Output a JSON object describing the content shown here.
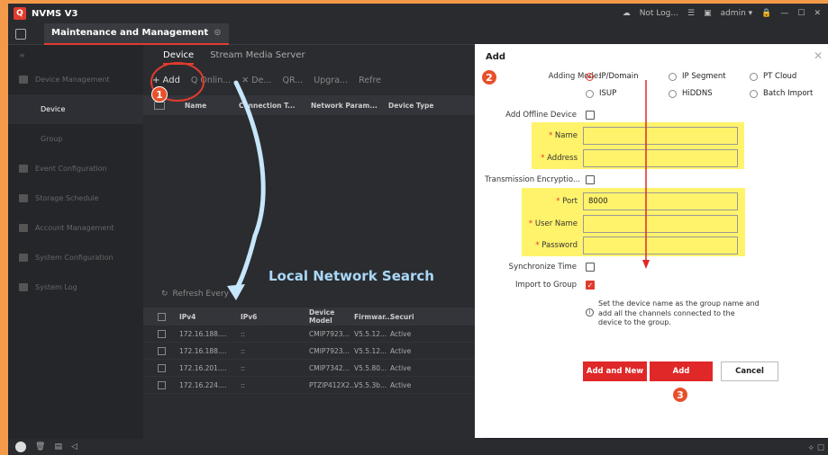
{
  "app": {
    "title": "NVMS V3",
    "logo_letter": "Q"
  },
  "titlebar": {
    "not_logged": "Not Log...",
    "user": "admin ▾"
  },
  "tab": {
    "label": "Maintenance and Management"
  },
  "sidebar": {
    "items": [
      {
        "label": "Device Management"
      },
      {
        "label": "Device"
      },
      {
        "label": "Group"
      },
      {
        "label": "Event Configuration"
      },
      {
        "label": "Storage Schedule"
      },
      {
        "label": "Account Management"
      },
      {
        "label": "System Configuration"
      },
      {
        "label": "System Log"
      }
    ]
  },
  "main": {
    "subtabs": [
      "Device",
      "Stream Media Server"
    ],
    "toolbar": {
      "add": "+ Add",
      "online": "Q Onlin...",
      "delete": "✕ De...",
      "qr": "QR...",
      "upgrade": "Upgra...",
      "refresh": "Refre"
    },
    "table_headers": [
      "Name",
      "Connection T...",
      "Network Param...",
      "Device Type"
    ],
    "refresh_every": "Refresh Every",
    "local_search_headers": [
      "IPv4",
      "IPv6",
      "Device Model",
      "Firmwar...",
      "Securi"
    ],
    "rows": [
      [
        "172.16.188....",
        "::",
        "CMIP7923...",
        "V5.5.12...",
        "Active"
      ],
      [
        "172.16.188....",
        "::",
        "CMIP7923...",
        "V5.5.12...",
        "Active"
      ],
      [
        "172.16.201....",
        "::",
        "CMIP7342...",
        "V5.5.80...",
        "Active"
      ],
      [
        "172.16.224....",
        "::",
        "PTZIP412X2...",
        "V5.5.3b...",
        "Active"
      ]
    ]
  },
  "annotation": {
    "local_search": "Local Network Search",
    "step1": "1",
    "step2": "2",
    "step3": "3"
  },
  "dialog": {
    "title": "Add",
    "adding_mode_label": "Adding Mode:",
    "modes": [
      "IP/Domain",
      "IP Segment",
      "PT Cloud",
      "ISUP",
      "HiDDNS",
      "Batch Import"
    ],
    "add_offline_label": "Add Offline Device",
    "name_label": "Name",
    "address_label": "Address",
    "transmission_label": "Transmission Encryptio...",
    "port_label": "Port",
    "port_value": "8000",
    "user_label": "User Name",
    "password_label": "Password",
    "sync_label": "Synchronize Time",
    "import_label": "Import to Group",
    "note": "Set the device name as the group name and add all the channels connected to the device to the group.",
    "btn_add_new": "Add and New",
    "btn_add": "Add",
    "btn_cancel": "Cancel"
  },
  "colors": {
    "accent": "#e02828",
    "highlight": "#fff36b",
    "background": "#f29a4a"
  }
}
